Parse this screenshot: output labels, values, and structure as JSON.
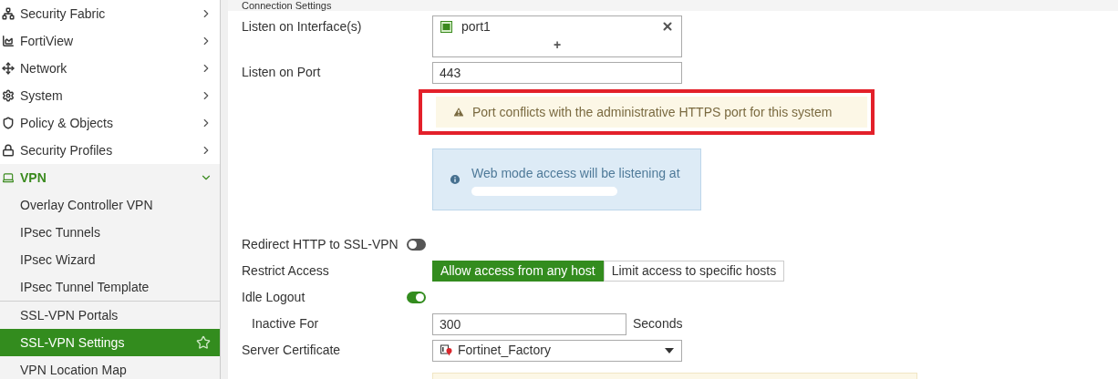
{
  "sidebar": {
    "items": [
      {
        "label": "Security Fabric",
        "expanded": false
      },
      {
        "label": "FortiView",
        "expanded": false
      },
      {
        "label": "Network",
        "expanded": false
      },
      {
        "label": "System",
        "expanded": false
      },
      {
        "label": "Policy & Objects",
        "expanded": false
      },
      {
        "label": "Security Profiles",
        "expanded": false
      },
      {
        "label": "VPN",
        "expanded": true,
        "children": [
          {
            "label": "Overlay Controller VPN",
            "selected": false,
            "separator_before": false
          },
          {
            "label": "IPsec Tunnels",
            "selected": false,
            "separator_before": false
          },
          {
            "label": "IPsec Wizard",
            "selected": false,
            "separator_before": false
          },
          {
            "label": "IPsec Tunnel Template",
            "selected": false,
            "separator_before": false
          },
          {
            "label": "SSL-VPN Portals",
            "selected": false,
            "separator_before": true
          },
          {
            "label": "SSL-VPN Settings",
            "selected": true,
            "separator_before": false
          },
          {
            "label": "VPN Location Map",
            "selected": false,
            "separator_before": false
          }
        ]
      }
    ]
  },
  "section": {
    "title": "Connection Settings",
    "fields": [
      {
        "kind": "interfaces",
        "label": "Listen on Interface(s)",
        "value": "port1",
        "add": "+"
      },
      {
        "kind": "text",
        "label": "Listen on Port",
        "value": "443"
      },
      {
        "kind": "warning",
        "text": "Port conflicts with the administrative HTTPS port for this system",
        "highlighted": true
      },
      {
        "kind": "info",
        "text": "Web mode access will be listening at",
        "redacted": true
      },
      {
        "kind": "toggle",
        "label": "Redirect HTTP to SSL-VPN",
        "on": false
      },
      {
        "kind": "segmented",
        "label": "Restrict Access",
        "options": [
          {
            "label": "Allow access from any host",
            "selected": true
          },
          {
            "label": "Limit access to specific hosts",
            "selected": false
          }
        ]
      },
      {
        "kind": "toggle",
        "label": "Idle Logout",
        "on": true
      },
      {
        "kind": "suffix",
        "label": "Inactive For",
        "value": "300",
        "suffix": "Seconds",
        "indented": true
      },
      {
        "kind": "select",
        "label": "Server Certificate",
        "value": "Fortinet_Factory"
      },
      {
        "kind": "notice"
      }
    ]
  }
}
